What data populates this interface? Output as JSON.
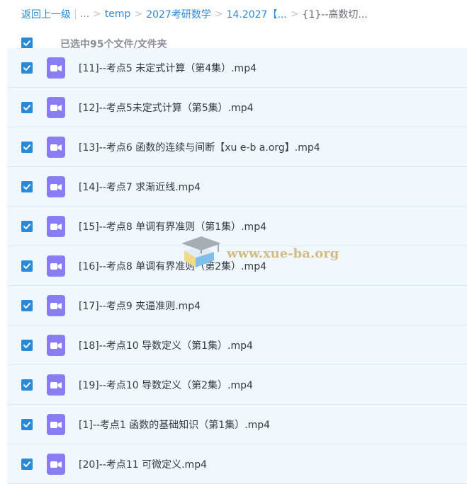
{
  "breadcrumb": {
    "back_label": "返回上一级",
    "bar_sep": "|",
    "ellipsis": "...",
    "sep": ">",
    "items": [
      "temp",
      "2027考研数学",
      "14.2027【...",
      "{1}--高数切..."
    ]
  },
  "selection": {
    "label": "已选中95个文件/文件夹",
    "all_checked": true
  },
  "files": [
    {
      "name": "[11]--考点5 未定式计算（第4集）.mp4",
      "checked": true
    },
    {
      "name": "[12]--考点5未定式计算（第5集）.mp4",
      "checked": true
    },
    {
      "name": "[13]--考点6 函数的连续与间断【xu e-b a.org】.mp4",
      "checked": true
    },
    {
      "name": "[14]--考点7 求渐近线.mp4",
      "checked": true
    },
    {
      "name": "[15]--考点8 单调有界准则（第1集）.mp4",
      "checked": true
    },
    {
      "name": "[16]--考点8 单调有界准则（第2集）.mp4",
      "checked": true
    },
    {
      "name": "[17]--考点9 夹逼准则.mp4",
      "checked": true
    },
    {
      "name": "[18]--考点10 导数定义（第1集）.mp4",
      "checked": true
    },
    {
      "name": "[19]--考点10 导数定义（第2集）.mp4",
      "checked": true
    },
    {
      "name": "[1]--考点1 函数的基础知识（第1集）.mp4",
      "checked": true
    },
    {
      "name": "[20]--考点11 可微定义.mp4",
      "checked": true
    }
  ],
  "watermark": {
    "text": "www.xue-ba.org",
    "icon": "graduation-cap-icon"
  },
  "colors": {
    "accent": "#2b8ad8",
    "row_bg": "#f0f7fd",
    "row_border": "#d8e9f7",
    "video_icon": "#8a7cf2",
    "file_text": "#333a44",
    "muted_text": "#8a8f99"
  },
  "icons": {
    "checkbox": "checkmark-icon",
    "file": "video-file-icon"
  }
}
